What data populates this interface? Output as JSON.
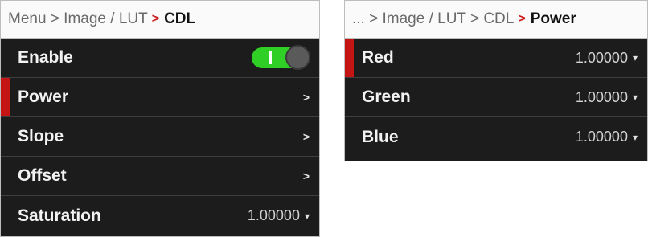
{
  "left_panel": {
    "breadcrumb": {
      "path": "Menu > Image / LUT",
      "separator": ">",
      "current": "CDL"
    },
    "rows": [
      {
        "label": "Enable",
        "toggle_on": true
      },
      {
        "label": "Power",
        "arrow": ">"
      },
      {
        "label": "Slope",
        "arrow": ">"
      },
      {
        "label": "Offset",
        "arrow": ">"
      },
      {
        "label": "Saturation",
        "value": "1.00000",
        "dropdown": "▾"
      }
    ]
  },
  "right_panel": {
    "breadcrumb": {
      "path": "... > Image / LUT > CDL",
      "separator": ">",
      "current": "Power"
    },
    "rows": [
      {
        "label": "Red",
        "value": "1.00000",
        "dropdown": "▾"
      },
      {
        "label": "Green",
        "value": "1.00000",
        "dropdown": "▾"
      },
      {
        "label": "Blue",
        "value": "1.00000",
        "dropdown": "▾"
      }
    ]
  },
  "colors": {
    "accent_red": "#c41414",
    "toggle_green": "#2fcf26",
    "row_background": "#1c1c1c"
  }
}
